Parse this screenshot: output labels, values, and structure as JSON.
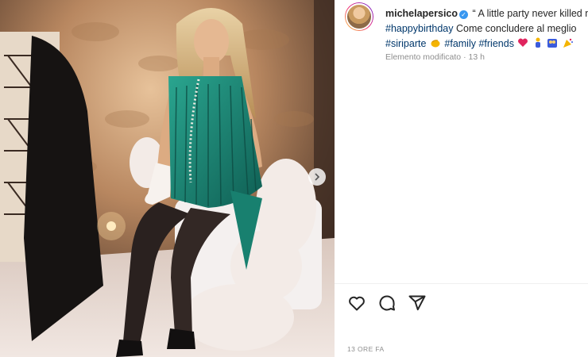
{
  "post": {
    "username": "michelapersico",
    "caption_start": "“ A little party never killed nobody”",
    "hashtag_1": "#happybirthday",
    "caption_middle": "Come concludere al meglio",
    "hashtag_2": "#siriparte",
    "hashtag_3": "#family",
    "hashtag_4": "#friends",
    "edited_label": "Elemento modificato",
    "edited_separator": "·",
    "edited_time": "13 h",
    "timestamp": "13 ORE FA"
  },
  "icons": {
    "verified": "verified-badge-icon",
    "next": "chevron-right-icon",
    "like": "heart-outline-icon",
    "comment": "comment-bubble-icon",
    "share": "paper-plane-icon"
  },
  "colors": {
    "hashtag": "#00376b",
    "verified": "#3897f0",
    "muted": "#8e8e8e",
    "dress": "#1f8c7a"
  }
}
